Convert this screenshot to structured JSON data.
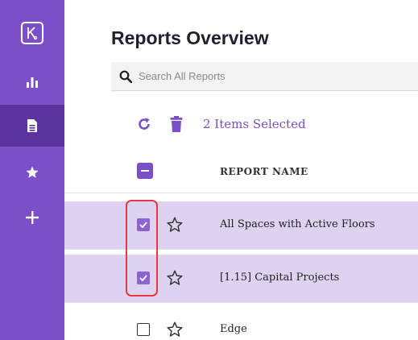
{
  "sidebar": {
    "items": [
      {
        "icon": "logo-icon"
      },
      {
        "icon": "bar-chart-icon"
      },
      {
        "icon": "document-icon",
        "active": true
      },
      {
        "icon": "star-icon"
      },
      {
        "icon": "plus-icon"
      }
    ]
  },
  "page": {
    "title": "Reports Overview"
  },
  "search": {
    "placeholder": "Search All Reports",
    "value": ""
  },
  "toolbar": {
    "refresh_icon": "refresh-icon",
    "delete_icon": "trash-icon",
    "selected_label": "2 Items Selected"
  },
  "table": {
    "column_header": "REPORT NAME",
    "rows": [
      {
        "name": "All Spaces with Active Floors",
        "checked": true,
        "favorite": false
      },
      {
        "name": "[1.15] Capital Projects",
        "checked": true,
        "favorite": false
      },
      {
        "name": "Edge",
        "checked": false,
        "favorite": false
      }
    ]
  },
  "colors": {
    "accent": "#7b4fc7",
    "sidebar_active": "#5b339e",
    "row_selected": "#ddd3f1",
    "highlight_outline": "#e5393b"
  }
}
